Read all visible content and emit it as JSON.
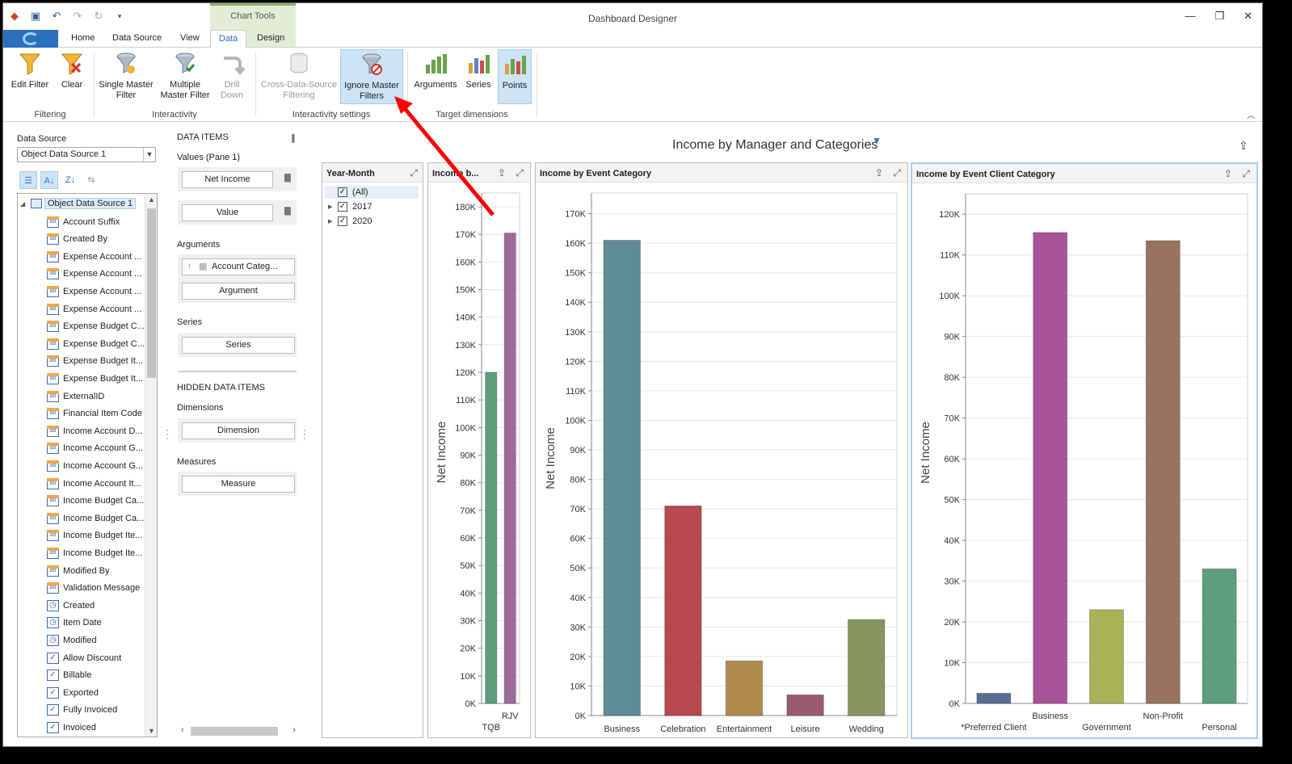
{
  "window": {
    "title": "Dashboard Designer",
    "context_tab_group": "Chart Tools",
    "controls": [
      "—",
      "❐",
      "✕"
    ]
  },
  "ribbon": {
    "tabs": [
      "Home",
      "Data Source",
      "View",
      "Data",
      "Design"
    ],
    "active_tab": "Data",
    "groups": [
      {
        "label": "Filtering",
        "buttons": [
          {
            "label": "Edit Filter"
          },
          {
            "label": "Clear"
          }
        ]
      },
      {
        "label": "Interactivity",
        "buttons": [
          {
            "label": "Single Master Filter"
          },
          {
            "label": "Multiple Master Filter"
          },
          {
            "label": "Drill Down"
          }
        ]
      },
      {
        "label": "Interactivity settings",
        "buttons": [
          {
            "label": "Cross-Data-Source Filtering"
          },
          {
            "label": "Ignore Master Filters"
          }
        ]
      },
      {
        "label": "Target dimensions",
        "buttons": [
          {
            "label": "Arguments"
          },
          {
            "label": "Series"
          },
          {
            "label": "Points"
          }
        ]
      }
    ]
  },
  "data_source": {
    "label": "Data Source",
    "selected": "Object Data Source 1",
    "root": "Object Data Source 1",
    "fields": [
      {
        "name": "Account Suffix",
        "type": "ab"
      },
      {
        "name": "Created By",
        "type": "ab"
      },
      {
        "name": "Expense Account ...",
        "type": "ab"
      },
      {
        "name": "Expense Account ...",
        "type": "ab"
      },
      {
        "name": "Expense Account ...",
        "type": "ab"
      },
      {
        "name": "Expense Account ...",
        "type": "ab"
      },
      {
        "name": "Expense Budget C...",
        "type": "ab"
      },
      {
        "name": "Expense Budget C...",
        "type": "ab"
      },
      {
        "name": "Expense Budget It...",
        "type": "ab"
      },
      {
        "name": "Expense Budget It...",
        "type": "ab"
      },
      {
        "name": "ExternalID",
        "type": "ab"
      },
      {
        "name": "Financial Item Code",
        "type": "ab"
      },
      {
        "name": "Income Account D...",
        "type": "ab"
      },
      {
        "name": "Income Account G...",
        "type": "ab"
      },
      {
        "name": "Income Account G...",
        "type": "ab"
      },
      {
        "name": "Income Account It...",
        "type": "ab"
      },
      {
        "name": "Income Budget Ca...",
        "type": "ab"
      },
      {
        "name": "Income Budget Ca...",
        "type": "ab"
      },
      {
        "name": "Income Budget Ite...",
        "type": "ab"
      },
      {
        "name": "Income Budget Ite...",
        "type": "ab"
      },
      {
        "name": "Modified By",
        "type": "ab"
      },
      {
        "name": "Validation Message",
        "type": "ab"
      },
      {
        "name": "Created",
        "type": "date"
      },
      {
        "name": "Item Date",
        "type": "date"
      },
      {
        "name": "Modified",
        "type": "date"
      },
      {
        "name": "Allow Discount",
        "type": "bool"
      },
      {
        "name": "Billable",
        "type": "bool"
      },
      {
        "name": "Exported",
        "type": "bool"
      },
      {
        "name": "Fully Invoiced",
        "type": "bool"
      },
      {
        "name": "Invoiced",
        "type": "bool"
      }
    ]
  },
  "data_items": {
    "title": "DATA ITEMS",
    "values_header": "Values (Pane 1)",
    "values": [
      "Net Income",
      "Value"
    ],
    "arguments_header": "Arguments",
    "arguments_item": "Account Categ...",
    "arguments_placeholder": "Argument",
    "series_header": "Series",
    "series_placeholder": "Series",
    "hidden_title": "HIDDEN DATA ITEMS",
    "dimensions_header": "Dimensions",
    "dimensions_placeholder": "Dimension",
    "measures_header": "Measures",
    "measures_placeholder": "Measure"
  },
  "dashboard": {
    "title": "Income by Manager and Categories",
    "filter_element": {
      "caption": "Year-Month",
      "items": [
        {
          "label": "(All)",
          "checked": true
        },
        {
          "label": "2017",
          "checked": true
        },
        {
          "label": "2020",
          "checked": true
        }
      ]
    }
  },
  "chart_data": [
    {
      "type": "bar",
      "title": "Income b...",
      "ylabel": "Net Income",
      "categories": [
        "TQB",
        "RJV"
      ],
      "values": [
        120000,
        170500
      ],
      "ylim": [
        0,
        185000
      ],
      "yticks": [
        0,
        10000,
        20000,
        30000,
        40000,
        50000,
        60000,
        70000,
        80000,
        90000,
        100000,
        110000,
        120000,
        130000,
        140000,
        150000,
        160000,
        170000,
        180000
      ],
      "colors": [
        "#5d9e7c",
        "#9d6a9a"
      ],
      "grid": true
    },
    {
      "type": "bar",
      "title": "Income by Event Category",
      "ylabel": "Net Income",
      "categories": [
        "Business",
        "Celebration",
        "Entertainment",
        "Leisure",
        "Wedding"
      ],
      "values": [
        161000,
        71000,
        18500,
        7000,
        32500
      ],
      "ylim": [
        0,
        177000
      ],
      "yticks": [
        0,
        10000,
        20000,
        30000,
        40000,
        50000,
        60000,
        70000,
        80000,
        90000,
        100000,
        110000,
        120000,
        130000,
        140000,
        150000,
        160000,
        170000
      ],
      "colors": [
        "#5f8b94",
        "#b9474f",
        "#b08a4e",
        "#9a5a70",
        "#86955f"
      ],
      "grid": true
    },
    {
      "type": "bar",
      "title": "Income by Event Client Category",
      "ylabel": "Net Income",
      "categories": [
        "*Preferred Client",
        "Business",
        "Government",
        "Non-Profit",
        "Personal"
      ],
      "values": [
        2500,
        115500,
        23000,
        113500,
        33000
      ],
      "ylim": [
        0,
        125000
      ],
      "yticks": [
        0,
        10000,
        20000,
        30000,
        40000,
        50000,
        60000,
        70000,
        80000,
        90000,
        100000,
        110000,
        120000
      ],
      "colors": [
        "#5b6c94",
        "#a8549a",
        "#a9b257",
        "#98735f",
        "#5d9e7c"
      ],
      "grid": true
    }
  ],
  "annotation": {
    "color": "#ff0000"
  }
}
